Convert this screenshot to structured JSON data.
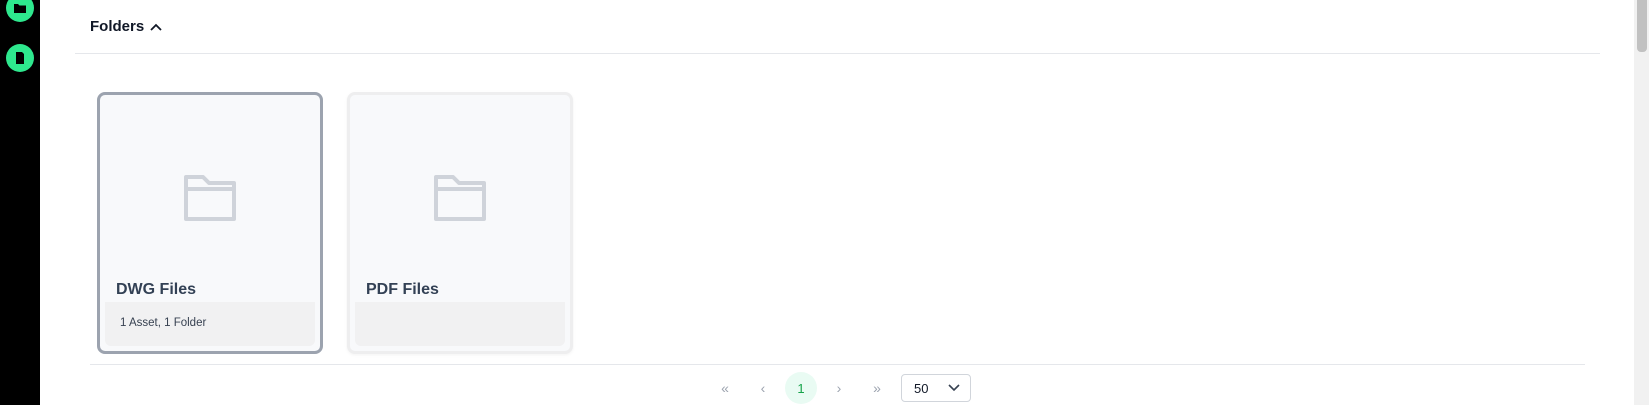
{
  "sidebar": {
    "items": [
      {
        "icon": "folder-icon"
      },
      {
        "icon": "document-icon"
      }
    ],
    "accent": "#2ee88e"
  },
  "section": {
    "title": "Folders",
    "toggle_icon": "chevron-up-icon"
  },
  "folders": [
    {
      "name": "DWG Files",
      "meta": "1 Asset, 1 Folder",
      "selected": true
    },
    {
      "name": "PDF Files",
      "meta": "",
      "selected": false
    }
  ],
  "pagination": {
    "first_icon": "«",
    "prev_icon": "‹",
    "current_page": "1",
    "next_icon": "›",
    "last_icon": "»",
    "page_size": "50"
  }
}
